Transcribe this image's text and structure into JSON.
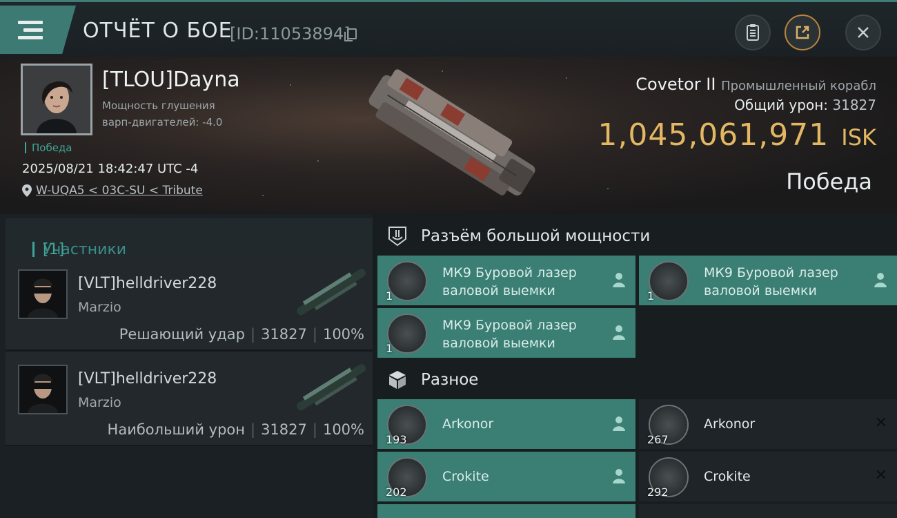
{
  "header": {
    "title": "ОТЧЁТ О БОЕ",
    "report_id": "[ID:11053894]",
    "icons": [
      "menu-icon",
      "copy-icon",
      "clipboard-icon",
      "share-icon",
      "close-icon"
    ]
  },
  "victim": {
    "name": "[TLOU]Dayna",
    "stat_line1": "Мощность глушения",
    "stat_line2": "варп-двигателей: -4.0",
    "tag": "Победа",
    "datetime": "2025/08/21 18:42:47 UTC -4",
    "location": "W-UQA5 < 03C-SU < Tribute",
    "ship_name": "Covetor II",
    "ship_class": "Промышленный корабл",
    "damage_label": "Общий урон:",
    "damage_value": "31827",
    "isk_value": "1,045,061,971",
    "isk_unit": "ISK",
    "result": "Победа"
  },
  "participants": {
    "label": "Участники",
    "count": "[1]",
    "list": [
      {
        "name": "[VLT]helldriver228",
        "corp": "Marzio",
        "role": "Решающий удар",
        "damage": "31827",
        "percent": "100%"
      },
      {
        "name": "[VLT]helldriver228",
        "corp": "Marzio",
        "role": "Наибольший урон",
        "damage": "31827",
        "percent": "100%"
      }
    ]
  },
  "sections": {
    "high_slots": {
      "title": "Разъём большой мощности",
      "items": [
        {
          "name": "МК9 Буровой лазер валовой выемки",
          "qty": "1",
          "state": "dropped"
        },
        {
          "name": "МК9 Буровой лазер валовой выемки",
          "qty": "1",
          "state": "dropped"
        },
        {
          "name": "МК9 Буровой лазер валовой выемки",
          "qty": "1",
          "state": "dropped"
        }
      ]
    },
    "misc": {
      "title": "Разное",
      "items": [
        {
          "name": "Arkonor",
          "qty": "193",
          "state": "dropped"
        },
        {
          "name": "Arkonor",
          "qty": "267",
          "state": "destroyed"
        },
        {
          "name": "Crokite",
          "qty": "202",
          "state": "dropped"
        },
        {
          "name": "Crokite",
          "qty": "292",
          "state": "destroyed"
        }
      ]
    }
  },
  "colors": {
    "accent": "#3a7e74",
    "isk": "#e4b863",
    "victory": "#3fa596"
  }
}
